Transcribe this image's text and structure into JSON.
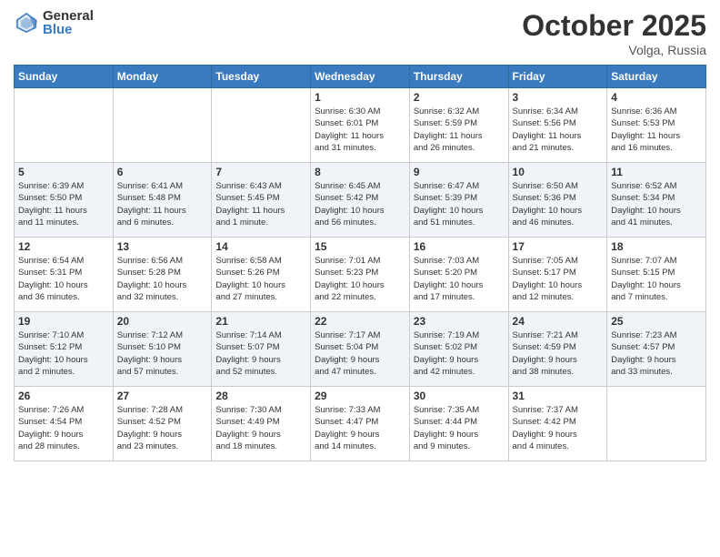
{
  "header": {
    "logo_general": "General",
    "logo_blue": "Blue",
    "month_title": "October 2025",
    "location": "Volga, Russia"
  },
  "weekdays": [
    "Sunday",
    "Monday",
    "Tuesday",
    "Wednesday",
    "Thursday",
    "Friday",
    "Saturday"
  ],
  "weeks": [
    [
      {
        "day": "",
        "info": ""
      },
      {
        "day": "",
        "info": ""
      },
      {
        "day": "",
        "info": ""
      },
      {
        "day": "1",
        "info": "Sunrise: 6:30 AM\nSunset: 6:01 PM\nDaylight: 11 hours\nand 31 minutes."
      },
      {
        "day": "2",
        "info": "Sunrise: 6:32 AM\nSunset: 5:59 PM\nDaylight: 11 hours\nand 26 minutes."
      },
      {
        "day": "3",
        "info": "Sunrise: 6:34 AM\nSunset: 5:56 PM\nDaylight: 11 hours\nand 21 minutes."
      },
      {
        "day": "4",
        "info": "Sunrise: 6:36 AM\nSunset: 5:53 PM\nDaylight: 11 hours\nand 16 minutes."
      }
    ],
    [
      {
        "day": "5",
        "info": "Sunrise: 6:39 AM\nSunset: 5:50 PM\nDaylight: 11 hours\nand 11 minutes."
      },
      {
        "day": "6",
        "info": "Sunrise: 6:41 AM\nSunset: 5:48 PM\nDaylight: 11 hours\nand 6 minutes."
      },
      {
        "day": "7",
        "info": "Sunrise: 6:43 AM\nSunset: 5:45 PM\nDaylight: 11 hours\nand 1 minute."
      },
      {
        "day": "8",
        "info": "Sunrise: 6:45 AM\nSunset: 5:42 PM\nDaylight: 10 hours\nand 56 minutes."
      },
      {
        "day": "9",
        "info": "Sunrise: 6:47 AM\nSunset: 5:39 PM\nDaylight: 10 hours\nand 51 minutes."
      },
      {
        "day": "10",
        "info": "Sunrise: 6:50 AM\nSunset: 5:36 PM\nDaylight: 10 hours\nand 46 minutes."
      },
      {
        "day": "11",
        "info": "Sunrise: 6:52 AM\nSunset: 5:34 PM\nDaylight: 10 hours\nand 41 minutes."
      }
    ],
    [
      {
        "day": "12",
        "info": "Sunrise: 6:54 AM\nSunset: 5:31 PM\nDaylight: 10 hours\nand 36 minutes."
      },
      {
        "day": "13",
        "info": "Sunrise: 6:56 AM\nSunset: 5:28 PM\nDaylight: 10 hours\nand 32 minutes."
      },
      {
        "day": "14",
        "info": "Sunrise: 6:58 AM\nSunset: 5:26 PM\nDaylight: 10 hours\nand 27 minutes."
      },
      {
        "day": "15",
        "info": "Sunrise: 7:01 AM\nSunset: 5:23 PM\nDaylight: 10 hours\nand 22 minutes."
      },
      {
        "day": "16",
        "info": "Sunrise: 7:03 AM\nSunset: 5:20 PM\nDaylight: 10 hours\nand 17 minutes."
      },
      {
        "day": "17",
        "info": "Sunrise: 7:05 AM\nSunset: 5:17 PM\nDaylight: 10 hours\nand 12 minutes."
      },
      {
        "day": "18",
        "info": "Sunrise: 7:07 AM\nSunset: 5:15 PM\nDaylight: 10 hours\nand 7 minutes."
      }
    ],
    [
      {
        "day": "19",
        "info": "Sunrise: 7:10 AM\nSunset: 5:12 PM\nDaylight: 10 hours\nand 2 minutes."
      },
      {
        "day": "20",
        "info": "Sunrise: 7:12 AM\nSunset: 5:10 PM\nDaylight: 9 hours\nand 57 minutes."
      },
      {
        "day": "21",
        "info": "Sunrise: 7:14 AM\nSunset: 5:07 PM\nDaylight: 9 hours\nand 52 minutes."
      },
      {
        "day": "22",
        "info": "Sunrise: 7:17 AM\nSunset: 5:04 PM\nDaylight: 9 hours\nand 47 minutes."
      },
      {
        "day": "23",
        "info": "Sunrise: 7:19 AM\nSunset: 5:02 PM\nDaylight: 9 hours\nand 42 minutes."
      },
      {
        "day": "24",
        "info": "Sunrise: 7:21 AM\nSunset: 4:59 PM\nDaylight: 9 hours\nand 38 minutes."
      },
      {
        "day": "25",
        "info": "Sunrise: 7:23 AM\nSunset: 4:57 PM\nDaylight: 9 hours\nand 33 minutes."
      }
    ],
    [
      {
        "day": "26",
        "info": "Sunrise: 7:26 AM\nSunset: 4:54 PM\nDaylight: 9 hours\nand 28 minutes."
      },
      {
        "day": "27",
        "info": "Sunrise: 7:28 AM\nSunset: 4:52 PM\nDaylight: 9 hours\nand 23 minutes."
      },
      {
        "day": "28",
        "info": "Sunrise: 7:30 AM\nSunset: 4:49 PM\nDaylight: 9 hours\nand 18 minutes."
      },
      {
        "day": "29",
        "info": "Sunrise: 7:33 AM\nSunset: 4:47 PM\nDaylight: 9 hours\nand 14 minutes."
      },
      {
        "day": "30",
        "info": "Sunrise: 7:35 AM\nSunset: 4:44 PM\nDaylight: 9 hours\nand 9 minutes."
      },
      {
        "day": "31",
        "info": "Sunrise: 7:37 AM\nSunset: 4:42 PM\nDaylight: 9 hours\nand 4 minutes."
      },
      {
        "day": "",
        "info": ""
      }
    ]
  ]
}
